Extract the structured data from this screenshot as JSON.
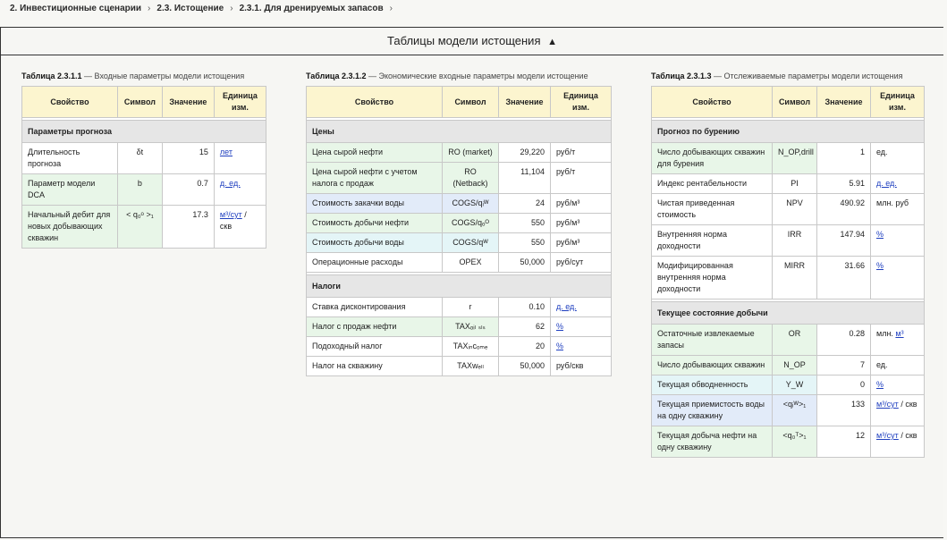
{
  "breadcrumb": [
    "2. Инвестиционные сценарии",
    "2.3. Истощение",
    "2.3.1. Для дренируемых запасов"
  ],
  "breadcrumb_sep": "›",
  "panel_title": "Таблицы модели истощения",
  "panel_toggle_icon": "▲",
  "headers": {
    "prop": "Свойство",
    "sym": "Символ",
    "val": "Значение",
    "unit": "Единица изм."
  },
  "tables": [
    {
      "caption_num": "Таблица 2.3.1.1",
      "caption_text": " — Входные параметры модели истощения",
      "sections": [
        {
          "title": "Параметры прогноза",
          "rows": [
            {
              "prop": "Длительность прогноза",
              "sym": "δt",
              "val": "15",
              "unit": "лет",
              "unit_link": true,
              "color": "w"
            },
            {
              "prop": "Параметр модели DCA",
              "sym": "b",
              "val": "0.7",
              "unit": "д. ед.",
              "unit_link": true,
              "color": "g"
            },
            {
              "prop": "Начальный дебит для новых добывающих скважин",
              "sym": "< q₀ᵒ >₁",
              "val": "17.3",
              "unit": "м³/сут",
              "unit_link": true,
              "unit_tail": " / скв",
              "color": "g"
            }
          ]
        }
      ]
    },
    {
      "caption_num": "Таблица 2.3.1.2",
      "caption_text": " — Экономические входные параметры модели истощение",
      "sections": [
        {
          "title": "Цены",
          "rows": [
            {
              "prop": "Цена сырой нефти",
              "sym": "RO (market)",
              "val": "29,220",
              "unit": "руб/т",
              "color": "g"
            },
            {
              "prop": "Цена сырой нефти с учетом налога с продаж",
              "sym": "RO (Netback)",
              "val": "11,104",
              "unit": "руб/т",
              "color": "g"
            },
            {
              "prop": "Стоимость закачки воды",
              "sym": "COGS/qᵢᵂ",
              "val": "24",
              "unit": "руб/м³",
              "color": "b"
            },
            {
              "prop": "Стоимость добычи нефти",
              "sym": "COGS/qₒᴼ",
              "val": "550",
              "unit": "руб/м³",
              "color": "g"
            },
            {
              "prop": "Стоимость добычи воды",
              "sym": "COGS/qᵂ",
              "val": "550",
              "unit": "руб/м³",
              "color": "c"
            },
            {
              "prop": "Операционные расходы",
              "sym": "OPEX",
              "val": "50,000",
              "unit": "руб/сут",
              "color": "w"
            }
          ]
        },
        {
          "title": "Налоги",
          "rows": [
            {
              "prop": "Ставка дисконтирования",
              "sym": "r",
              "val": "0.10",
              "unit": "д. ед.",
              "unit_link": true,
              "color": "w"
            },
            {
              "prop": "Налог с продаж нефти",
              "sym": "TAXₒᵢₗ ₛₗₛ",
              "val": "62",
              "unit": "%",
              "unit_link": true,
              "color": "g"
            },
            {
              "prop": "Подоходный налог",
              "sym": "TAXᵢₙcₒₘₑ",
              "val": "20",
              "unit": "%",
              "unit_link": true,
              "color": "w"
            },
            {
              "prop": "Налог на скважину",
              "sym": "TAXwₑₗₗ",
              "val": "50,000",
              "unit": "руб/скв",
              "color": "w"
            }
          ]
        }
      ]
    },
    {
      "caption_num": "Таблица 2.3.1.3",
      "caption_text": " — Отслеживаемые параметры модели истощения",
      "sections": [
        {
          "title": "Прогноз по бурению",
          "rows": [
            {
              "prop": "Число добывающих скважин для бурения",
              "sym": "N_OP,drill",
              "val": "1",
              "unit": "ед.",
              "color": "g"
            },
            {
              "prop": "Индекс рентабельности",
              "sym": "PI",
              "val": "5.91",
              "unit": "д. ед.",
              "unit_link": true,
              "color": "w"
            },
            {
              "prop": "Чистая приведенная стоимость",
              "sym": "NPV",
              "val": "490.92",
              "unit": "млн. руб",
              "color": "w"
            },
            {
              "prop": "Внутренняя норма доходности",
              "sym": "IRR",
              "val": "147.94",
              "unit": "%",
              "unit_link": true,
              "color": "w"
            },
            {
              "prop": "Модифицированная внутренняя норма доходности",
              "sym": "MIRR",
              "val": "31.66",
              "unit": "%",
              "unit_link": true,
              "color": "w"
            }
          ]
        },
        {
          "title": "Текущее состояние добычи",
          "rows": [
            {
              "prop": "Остаточные извлекаемые запасы",
              "sym": "OR",
              "val": "0.28",
              "unit_pre": "млн. ",
              "unit": "м³",
              "unit_link": true,
              "color": "g"
            },
            {
              "prop": "Число добывающих скважин",
              "sym": "N_OP",
              "val": "7",
              "unit": "ед.",
              "color": "g"
            },
            {
              "prop": "Текущая обводненность",
              "sym": "Y_W",
              "val": "0",
              "unit": "%",
              "unit_link": true,
              "color": "c"
            },
            {
              "prop": "Текущая приемистость воды на одну скважину",
              "sym": "<qᵢᵂ>₁",
              "val": "133",
              "unit": "м³/сут",
              "unit_link": true,
              "unit_tail": " / скв",
              "color": "b"
            },
            {
              "prop": "Текущая добыча нефти на одну скважину",
              "sym": "<q₀ᵀ>₁",
              "val": "12",
              "unit": "м³/сут",
              "unit_link": true,
              "unit_tail": " / скв",
              "color": "g"
            }
          ]
        }
      ]
    }
  ]
}
